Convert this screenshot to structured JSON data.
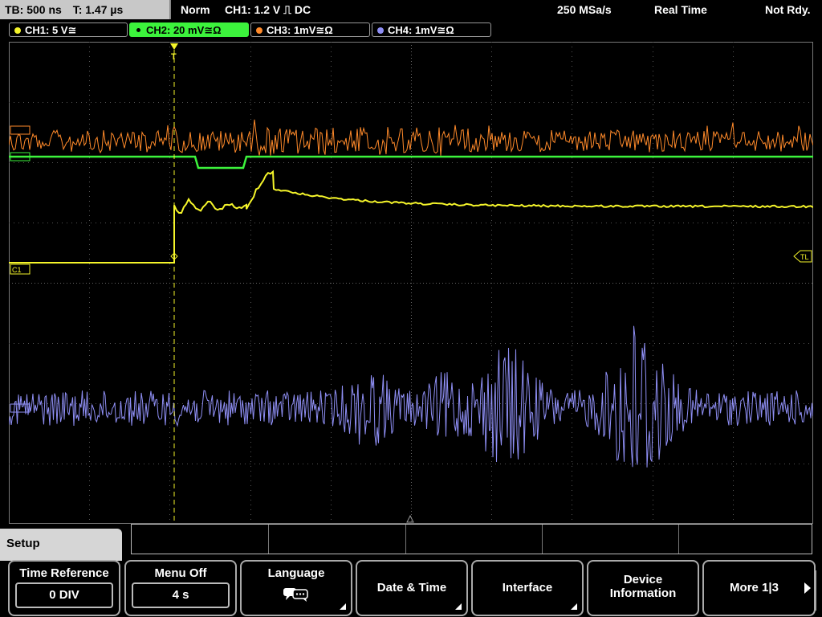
{
  "topbar": {
    "timebase": "TB: 500 ns",
    "trigger_time": "T: 1.47 µs",
    "trigger_mode": "Norm",
    "trigger_info": "CH1: 1.2 V ⎍ DC",
    "sample_rate": "250 MSa/s",
    "acq_mode": "Real Time",
    "status": "Not Rdy."
  },
  "channels": [
    {
      "label": "CH1: 5 V≅",
      "color": "#f5f52a"
    },
    {
      "label": "CH2: 20 mV≅Ω",
      "color": "#3cf33c"
    },
    {
      "label": "CH3: 1mV≅Ω",
      "color": "#ff8a2a"
    },
    {
      "label": "CH4: 1mV≅Ω",
      "color": "#8f8ff5"
    }
  ],
  "markers": {
    "ch1": "C1",
    "tl": "TL",
    "ch2": "C2",
    "ch3": "C3",
    "ch4": "C4",
    "trigger": "T"
  },
  "setup": {
    "title": "Setup"
  },
  "softkeys": {
    "time_reference": {
      "label": "Time Reference",
      "value": "0 DIV"
    },
    "menu_off": {
      "label": "Menu Off",
      "value": "4 s"
    },
    "language": {
      "label": "Language",
      "icon": "speech-bubbles-icon"
    },
    "date_time": {
      "label": "Date & Time"
    },
    "interface": {
      "label": "Interface"
    },
    "device_info": {
      "label1": "Device",
      "label2": "Information"
    },
    "more": {
      "label": "More 1|3"
    }
  }
}
